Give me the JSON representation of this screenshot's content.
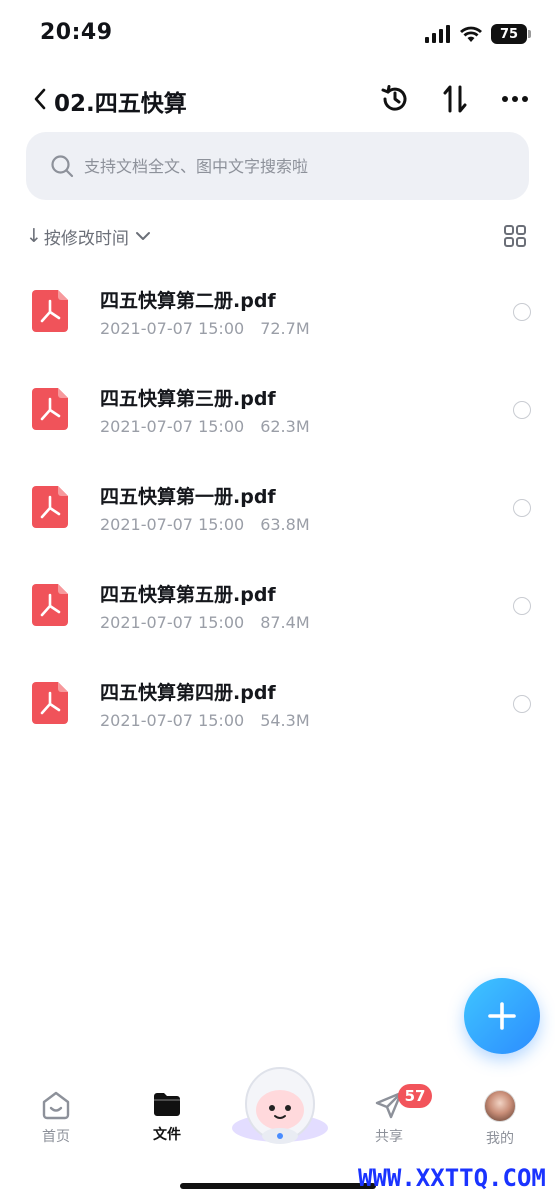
{
  "status_bar": {
    "time": "20:49",
    "battery": "75"
  },
  "header": {
    "title": "02.四五快算"
  },
  "search": {
    "placeholder": "支持文档全文、图中文字搜索啦"
  },
  "sort": {
    "label": "按修改时间"
  },
  "files": [
    {
      "name": "四五快算第二册.pdf",
      "date": "2021-07-07 15:00",
      "size": "72.7M"
    },
    {
      "name": "四五快算第三册.pdf",
      "date": "2021-07-07 15:00",
      "size": "62.3M"
    },
    {
      "name": "四五快算第一册.pdf",
      "date": "2021-07-07 15:00",
      "size": "63.8M"
    },
    {
      "name": "四五快算第五册.pdf",
      "date": "2021-07-07 15:00",
      "size": "87.4M"
    },
    {
      "name": "四五快算第四册.pdf",
      "date": "2021-07-07 15:00",
      "size": "54.3M"
    }
  ],
  "tabs": {
    "home": "首页",
    "files": "文件",
    "share": "共享",
    "mine": "我的"
  },
  "share_badge": "57",
  "watermark": "WWW.XXTTQ.COM",
  "colors": {
    "accent": "#2c8cff",
    "pdf_red": "#f0535a",
    "badge_red": "#f2545b"
  },
  "icons": [
    "back-chevron-icon",
    "history-icon",
    "sort-icon",
    "more-icon",
    "search-icon",
    "grid-icon",
    "pdf-icon",
    "plus-icon",
    "home-icon",
    "folder-icon",
    "send-icon"
  ]
}
